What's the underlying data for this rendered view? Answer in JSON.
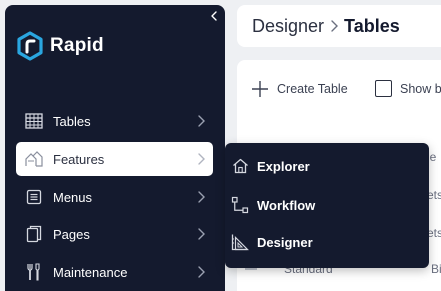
{
  "app": {
    "name": "Rapid"
  },
  "header": {
    "breadcrumb": [
      "Designer",
      "Tables"
    ]
  },
  "sidebar": {
    "items": [
      {
        "label": "Tables",
        "icon": "table-grid-icon"
      },
      {
        "label": "Features",
        "icon": "features-icon",
        "active": true
      },
      {
        "label": "Menus",
        "icon": "menu-list-icon"
      },
      {
        "label": "Pages",
        "icon": "pages-icon"
      },
      {
        "label": "Maintenance",
        "icon": "wrench-icon"
      }
    ]
  },
  "flyout": {
    "items": [
      {
        "label": "Explorer",
        "icon": "home-icon"
      },
      {
        "label": "Workflow",
        "icon": "workflow-icon"
      },
      {
        "label": "Designer",
        "icon": "designer-icon"
      }
    ]
  },
  "toolbar": {
    "create_label": "Create Table",
    "show_label": "Show b"
  },
  "table_peek": {
    "rows": [
      {
        "col2": "le"
      },
      {
        "col2": "ets"
      },
      {
        "col2": "ets"
      },
      {
        "col1": "Standard",
        "col2": "Bill Lin"
      }
    ]
  },
  "colors": {
    "sidebar_bg": "#141a2e",
    "active_bg": "#ffffff",
    "brand_accent": "#2aa6e0",
    "page_bg": "#eef0f3"
  }
}
